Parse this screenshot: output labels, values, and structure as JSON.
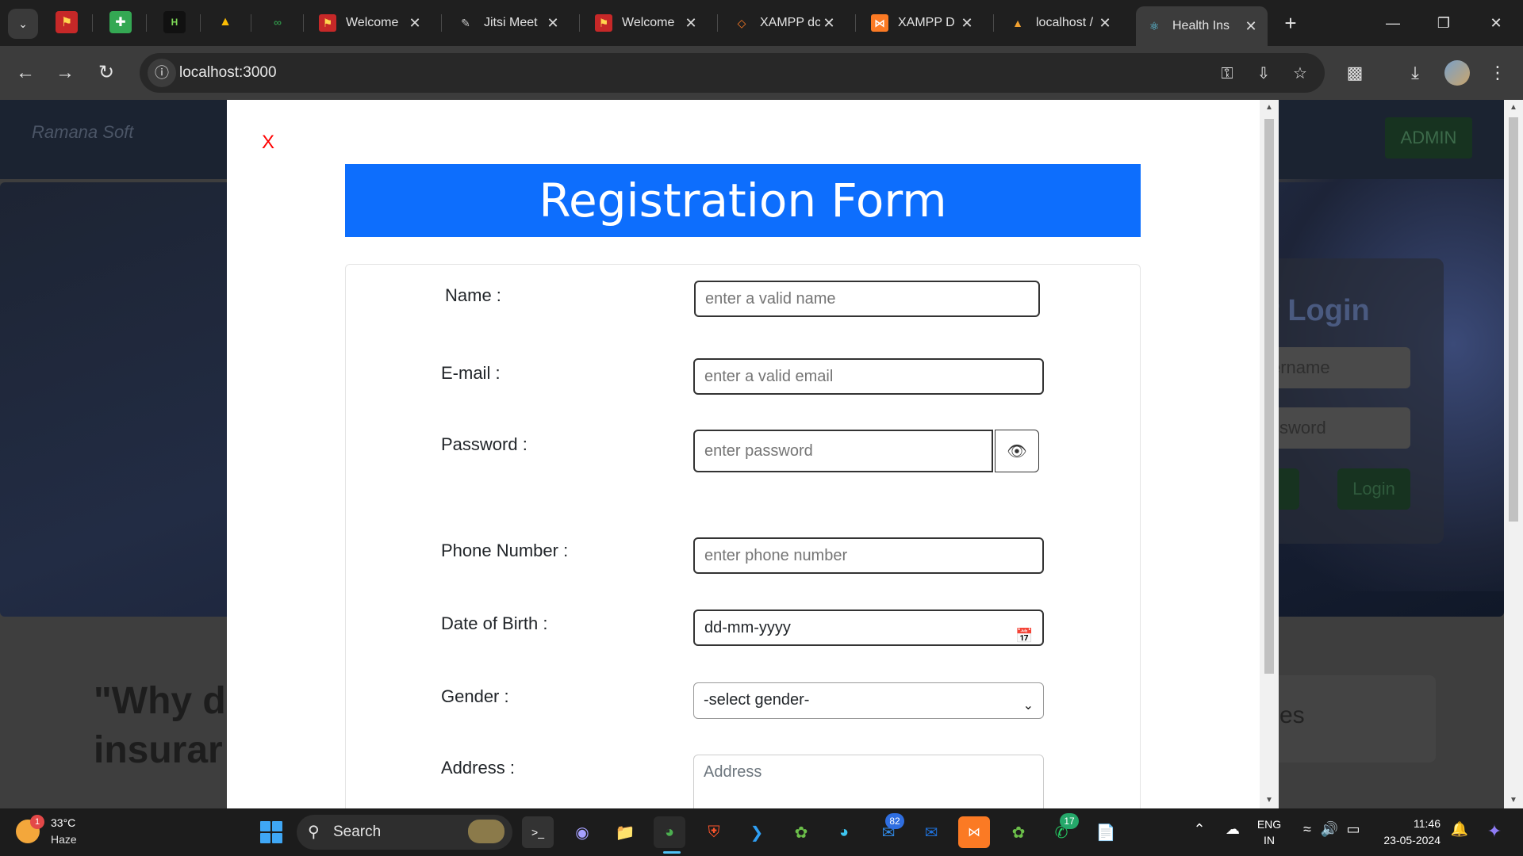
{
  "browser": {
    "tabs": [
      {
        "title": "Welcome",
        "favicon": "xampp-flag-icon"
      },
      {
        "title": "Jitsi Meet",
        "favicon": "pen-icon"
      },
      {
        "title": "Welcome",
        "favicon": "xampp-flag-icon"
      },
      {
        "title": "XAMPP dc",
        "favicon": "xampp-diamond-icon"
      },
      {
        "title": "XAMPP D",
        "favicon": "xampp-logo-icon"
      },
      {
        "title": "localhost /",
        "favicon": "phpmyadmin-icon"
      },
      {
        "title": "Health Ins",
        "favicon": "react-icon",
        "active": true
      }
    ],
    "url": "localhost:3000"
  },
  "background": {
    "brand": "Ramana Soft",
    "admin_button": "ADMIN",
    "login_title": "r Login",
    "username_placeholder": "ername",
    "password_placeholder": "ssword",
    "register_button": "r",
    "login_button": "Login",
    "why_line1": "\"Why d",
    "why_line2": "insurar",
    "card_text": "ses"
  },
  "modal": {
    "close_label": "X",
    "title": "Registration Form",
    "fields": {
      "name": {
        "label": "Name :",
        "placeholder": "enter a valid name"
      },
      "email": {
        "label": "E-mail :",
        "placeholder": "enter a valid email"
      },
      "password": {
        "label": "Password :",
        "placeholder": "enter password"
      },
      "phone": {
        "label": "Phone Number :",
        "placeholder": "enter phone number"
      },
      "dob": {
        "label": "Date of Birth :",
        "value": "dd-mm-yyyy"
      },
      "gender": {
        "label": "Gender :",
        "selected": "-select gender-"
      },
      "address": {
        "label": "Address :",
        "placeholder": "Address"
      }
    }
  },
  "taskbar": {
    "weather_temp": "33°C",
    "weather_condition": "Haze",
    "weather_badge": "1",
    "search_label": "Search",
    "outlook_badge": "82",
    "whatsapp_badge": "17",
    "language_line1": "ENG",
    "language_line2": "IN",
    "time": "11:46",
    "date": "23-05-2024"
  },
  "colors": {
    "form_title_bg": "#0d6efd",
    "close_x": "#ff0000",
    "chrome_bg": "#1f1f1f",
    "toolbar_bg": "#3c3c3c"
  }
}
